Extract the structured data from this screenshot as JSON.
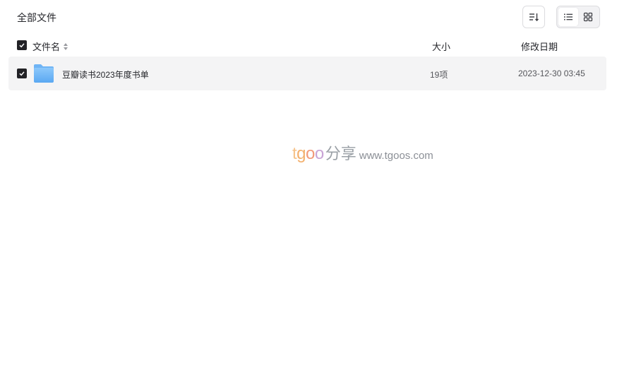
{
  "breadcrumb": {
    "label": "全部文件"
  },
  "toolbar": {
    "sort_icon": "sort-descending-icon",
    "view_list_icon": "list-view-icon",
    "view_grid_icon": "grid-view-icon",
    "active_view": "list"
  },
  "table": {
    "columns": {
      "name": "文件名",
      "size": "大小",
      "date": "修改日期"
    },
    "rows": [
      {
        "name": "豆瓣读书2023年度书单",
        "size": "19项",
        "date": "2023-12-30 03:45",
        "type": "folder",
        "checked": true
      }
    ]
  },
  "watermark": {
    "logo_t": "t",
    "logo_g": "g",
    "logo_o1": "o",
    "logo_o2": "o",
    "logo_cn": "分享",
    "url": "www.tgoos.com"
  },
  "colors": {
    "row_bg": "#f4f4f5",
    "checkbox": "#222226",
    "folder": "#6fb4f5"
  }
}
